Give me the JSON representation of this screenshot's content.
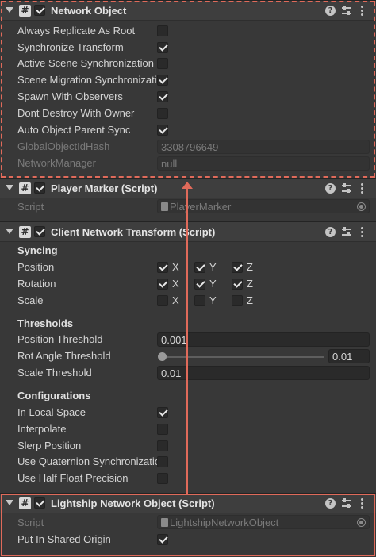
{
  "network_object": {
    "title": "Network Object",
    "enabled": true,
    "fields": [
      {
        "label": "Always Replicate As Root",
        "checked": false
      },
      {
        "label": "Synchronize Transform",
        "checked": true
      },
      {
        "label": "Active Scene Synchronization",
        "checked": false
      },
      {
        "label": "Scene Migration Synchronization",
        "checked": true
      },
      {
        "label": "Spawn With Observers",
        "checked": true
      },
      {
        "label": "Dont Destroy With Owner",
        "checked": false
      },
      {
        "label": "Auto Object Parent Sync",
        "checked": true
      }
    ],
    "global_hash_label": "GlobalObjectIdHash",
    "global_hash_value": "3308796649",
    "network_manager_label": "NetworkManager",
    "network_manager_value": "null"
  },
  "player_marker": {
    "title": "Player Marker (Script)",
    "enabled": true,
    "script_label": "Script",
    "script_value": "PlayerMarker"
  },
  "client_network_transform": {
    "title": "Client Network Transform (Script)",
    "enabled": true,
    "syncing_heading": "Syncing",
    "syncing_rows": [
      {
        "label": "Position",
        "x": true,
        "y": true,
        "z": true
      },
      {
        "label": "Rotation",
        "x": true,
        "y": true,
        "z": true
      },
      {
        "label": "Scale",
        "x": false,
        "y": false,
        "z": false
      }
    ],
    "axis_labels": [
      "X",
      "Y",
      "Z"
    ],
    "thresholds_heading": "Thresholds",
    "position_threshold_label": "Position Threshold",
    "position_threshold_value": "0.001",
    "rot_angle_threshold_label": "Rot Angle Threshold",
    "rot_angle_threshold_value": "0.01",
    "rot_angle_slider_fraction": 0.0,
    "scale_threshold_label": "Scale Threshold",
    "scale_threshold_value": "0.01",
    "configurations_heading": "Configurations",
    "config_rows": [
      {
        "label": "In Local Space",
        "checked": true
      },
      {
        "label": "Interpolate",
        "checked": false
      },
      {
        "label": "Slerp Position",
        "checked": false
      },
      {
        "label": "Use Quaternion Synchronization",
        "checked": false
      },
      {
        "label": "Use Half Float Precision",
        "checked": false
      }
    ]
  },
  "lightship_network_object": {
    "title": "Lightship Network Object (Script)",
    "enabled": true,
    "script_label": "Script",
    "script_value": "LightshipNetworkObject",
    "shared_origin_label": "Put In Shared Origin",
    "shared_origin_checked": true
  },
  "colors": {
    "highlight": "#e06a5a",
    "background": "#383838",
    "header": "#3e3e3e"
  }
}
